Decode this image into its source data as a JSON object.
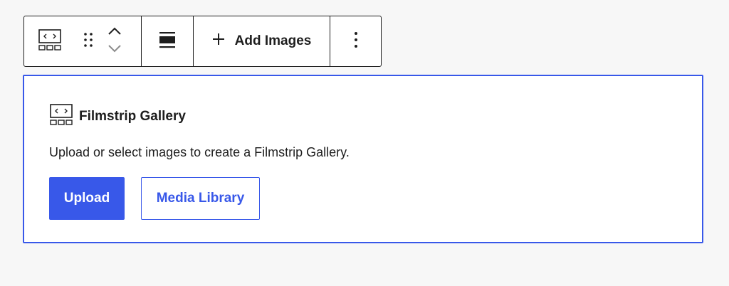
{
  "toolbar": {
    "block_icon": "filmstrip-gallery-icon",
    "drag_icon": "drag-handle-icon",
    "move_up_icon": "chevron-up-icon",
    "move_down_icon": "chevron-down-icon",
    "align_icon": "align-wide-icon",
    "add_images_icon": "plus-icon",
    "add_images_label": "Add Images",
    "options_icon": "more-vertical-icon"
  },
  "block": {
    "icon": "filmstrip-gallery-icon",
    "title": "Filmstrip Gallery",
    "instructions": "Upload or select images to create a Filmstrip Gallery.",
    "upload_label": "Upload",
    "media_library_label": "Media Library"
  },
  "colors": {
    "accent": "#3858e9",
    "text": "#1e1e1e",
    "muted": "#8c8c8c",
    "background": "#f7f7f7"
  }
}
